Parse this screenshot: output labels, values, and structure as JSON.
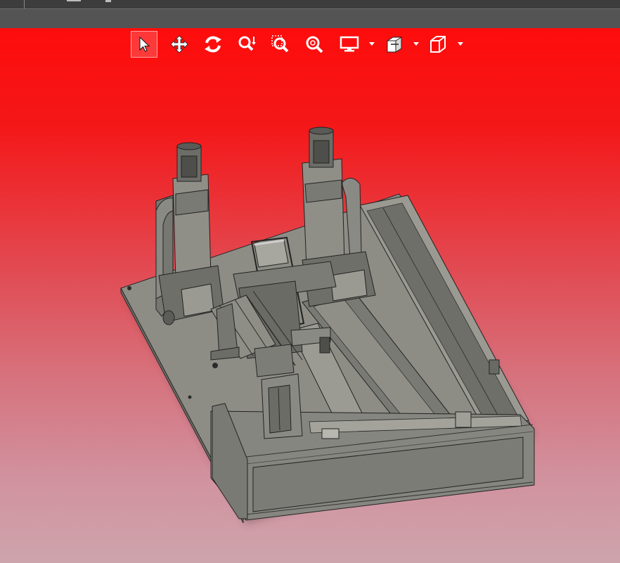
{
  "window": {
    "topbar": "cad-title-bar",
    "ribbon": "cad-ribbon"
  },
  "viewport": {
    "background_top": "#ff0c0c",
    "background_bottom": "#cea4ac",
    "model_color": "#8d8d86",
    "edge_color": "#2a2a2a"
  },
  "view_toolbar": {
    "tools": [
      {
        "name": "select-tool",
        "icon": "arrow-cursor-icon",
        "active": true
      },
      {
        "name": "pan-tool",
        "icon": "move-arrows-icon",
        "active": false
      },
      {
        "name": "rotate-tool",
        "icon": "rotate-icon",
        "active": false
      },
      {
        "name": "zoom-tool",
        "icon": "zoom-in-out-icon",
        "active": false
      },
      {
        "name": "zoom-window-tool",
        "icon": "zoom-window-icon",
        "active": false
      },
      {
        "name": "zoom-fit-tool",
        "icon": "zoom-fit-icon",
        "active": false
      },
      {
        "name": "display-style-tool",
        "icon": "monitor-icon",
        "active": false,
        "dropdown": true
      },
      {
        "name": "section-view-tool",
        "icon": "section-cube-icon",
        "active": false,
        "dropdown": true
      },
      {
        "name": "standard-views-tool",
        "icon": "cube-icon",
        "active": false,
        "dropdown": true
      }
    ]
  }
}
